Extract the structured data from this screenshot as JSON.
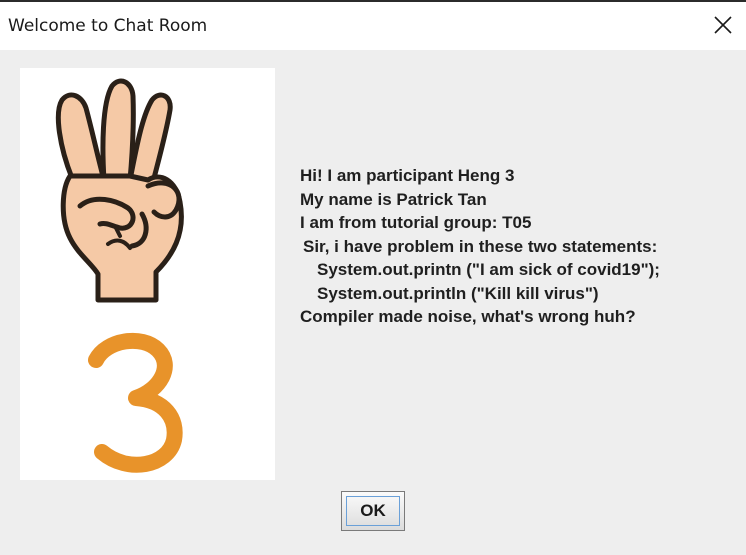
{
  "window": {
    "title": "Welcome to Chat Room"
  },
  "icons": {
    "close": "close-icon",
    "hand": "three-fingers-hand-icon",
    "digit": "number-three-icon"
  },
  "colors": {
    "hand_skin": "#f5c9a6",
    "hand_outline": "#2a2018",
    "digit": "#e8932a"
  },
  "message": {
    "lines": [
      "Hi! I am participant Heng 3",
      "My name is Patrick Tan",
      "I am from tutorial group: T05",
      "Sir, i have problem in these two statements:",
      "System.out.printn (\"I am sick of covid19\");",
      "System.out.println (\"Kill kill virus\")",
      "Compiler made noise, what's wrong huh?"
    ]
  },
  "buttons": {
    "ok": "OK"
  }
}
